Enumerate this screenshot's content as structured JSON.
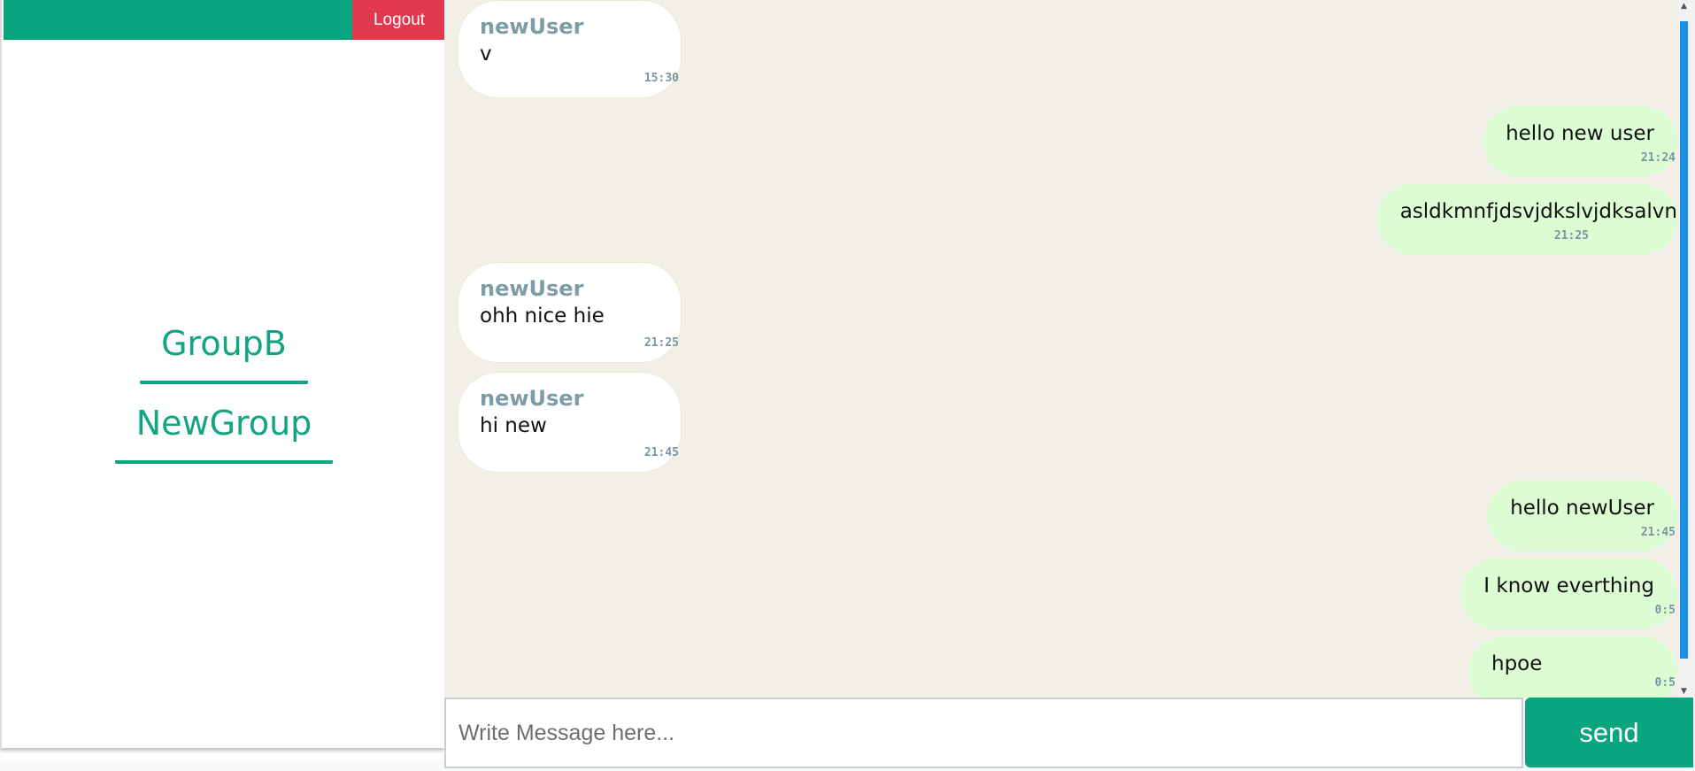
{
  "sidebar": {
    "logout_label": "Logout",
    "groups": [
      "GroupB",
      "NewGroup"
    ]
  },
  "chat": {
    "messages": [
      {
        "type": "received",
        "sender": "newUser",
        "text": "v",
        "time": "15:30"
      },
      {
        "type": "sent",
        "text": "hello new user",
        "time": "21:24"
      },
      {
        "type": "sent",
        "text": "asldkmnfjdsvjdkslvjdksalvn",
        "time": "21:25"
      },
      {
        "type": "received",
        "sender": "newUser",
        "text": "ohh nice hie",
        "time": "21:25"
      },
      {
        "type": "received",
        "sender": "newUser",
        "text": "hi new",
        "time": "21:45"
      },
      {
        "type": "sent",
        "text": "hello newUser",
        "time": "21:45"
      },
      {
        "type": "sent",
        "text": "I know everthing",
        "time": "0:5"
      },
      {
        "type": "sent",
        "text": "hpoe",
        "time": "0:5"
      }
    ]
  },
  "composer": {
    "placeholder": "Write Message here...",
    "send_label": "send"
  },
  "colors": {
    "brand": "#0aa57f",
    "logout": "#e0384c",
    "sent_bubble": "#dcfcd3",
    "chat_background": "#f2efe8",
    "sender_name": "#7e9ba8"
  },
  "icons": {
    "scroll_up": "chevron-up-icon",
    "scroll_down": "chevron-down-icon"
  }
}
